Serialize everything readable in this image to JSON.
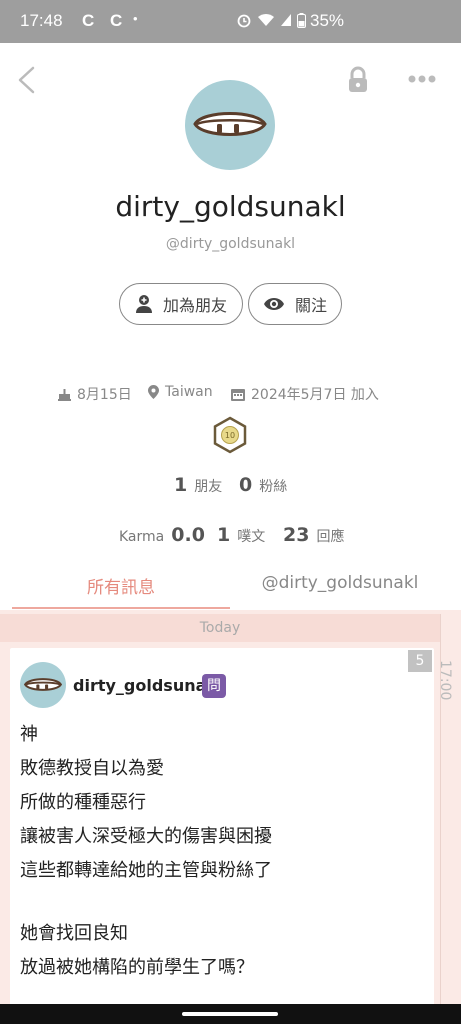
{
  "status_bar": {
    "time": "17:48",
    "notif1": "C",
    "notif2": "C",
    "dot": "•",
    "battery": "35%",
    "icons": [
      "alarm-icon",
      "wifi-icon",
      "signal-icon",
      "battery-icon"
    ]
  },
  "nav": {
    "back_icon": "chevron-left-icon",
    "lock_icon": "lock-icon",
    "more_icon": "more-dots-icon"
  },
  "profile": {
    "username": "dirty_goldsunakl",
    "handle": "@dirty_goldsunakl",
    "add_friend_label": "加為朋友",
    "follow_label": "關注",
    "birthday": "8月15日",
    "location": "Taiwan",
    "joined": "2024年5月7日 加入",
    "badge_level": "10"
  },
  "counts": {
    "friends_num": "1",
    "friends_label": "朋友",
    "fans_num": "0",
    "fans_label": "粉絲",
    "karma_label": "Karma",
    "karma_value": "0.0",
    "posts_num": "1",
    "posts_label": "噗文",
    "replies_num": "23",
    "replies_label": "回應"
  },
  "tabs": {
    "all_messages": "所有訊息",
    "user_handle": "@dirty_goldsunakl"
  },
  "feed": {
    "date_separator": "Today",
    "time": "17:00",
    "post": {
      "user": "dirty_goldsunakl",
      "qualifier": "問",
      "reply_count": "5",
      "lines": [
        "神",
        "敗德教授自以為愛",
        "所做的種種惡行",
        "讓被害人深受極大的傷害與困擾",
        "這些都轉達給她的主管與粉絲了",
        "",
        "她會找回良知",
        "放過被她構陷的前學生了嗎？"
      ]
    }
  },
  "colors": {
    "status_bar": "#9e9e9e",
    "avatar_bg": "#a9cfd6",
    "active_tab": "#e58a7e",
    "feed_bg": "#fbeae6",
    "qualifier_bg": "#7b5aa6"
  }
}
